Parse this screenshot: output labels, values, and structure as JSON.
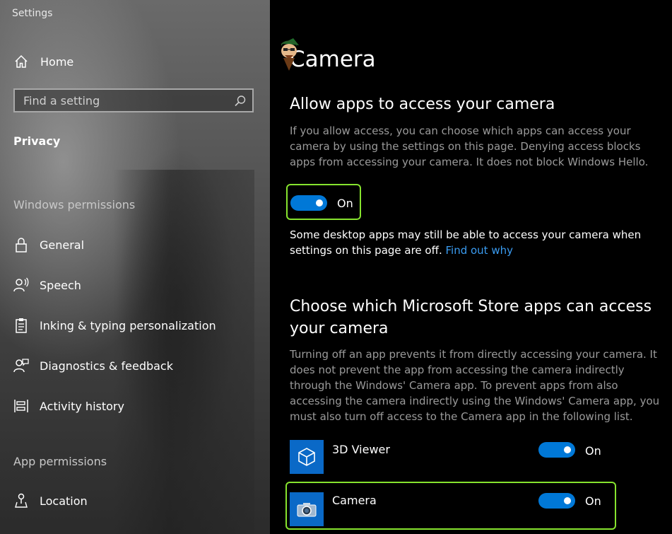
{
  "window": {
    "title": "Settings"
  },
  "sidebar": {
    "home_label": "Home",
    "search_placeholder": "Find a setting",
    "category": "Privacy",
    "windows_permissions_heading": "Windows permissions",
    "windows_items": [
      {
        "label": "General",
        "icon": "lock-icon"
      },
      {
        "label": "Speech",
        "icon": "speech-icon"
      },
      {
        "label": "Inking & typing personalization",
        "icon": "clipboard-icon"
      },
      {
        "label": "Diagnostics & feedback",
        "icon": "feedback-icon"
      },
      {
        "label": "Activity history",
        "icon": "activity-icon"
      }
    ],
    "app_permissions_heading": "App permissions",
    "app_items": [
      {
        "label": "Location",
        "icon": "location-icon"
      }
    ]
  },
  "main": {
    "title": "Camera",
    "allow_section": {
      "heading": "Allow apps to access your camera",
      "description": "If you allow access, you can choose which apps can access your camera by using the settings on this page. Denying access blocks apps from accessing your camera. It does not block Windows Hello.",
      "toggle_state": "On",
      "note": "Some desktop apps may still be able to access your camera when settings on this page are off.",
      "note_link": "Find out why"
    },
    "store_section": {
      "heading": "Choose which Microsoft Store apps can access your camera",
      "description": "Turning off an app prevents it from directly accessing your camera. It does not prevent the app from accessing the camera indirectly through the Windows' Camera app. To prevent apps from also accessing the camera indirectly using the Windows' Camera app, you must also turn off access to the Camera app in the following list.",
      "apps": [
        {
          "name": "3D Viewer",
          "state": "On",
          "icon": "cube-icon"
        },
        {
          "name": "Camera",
          "state": "On",
          "icon": "camera-icon"
        }
      ]
    }
  },
  "colors": {
    "accent": "#0078d7",
    "highlight": "#86e32e",
    "link": "#3a9bf0"
  }
}
